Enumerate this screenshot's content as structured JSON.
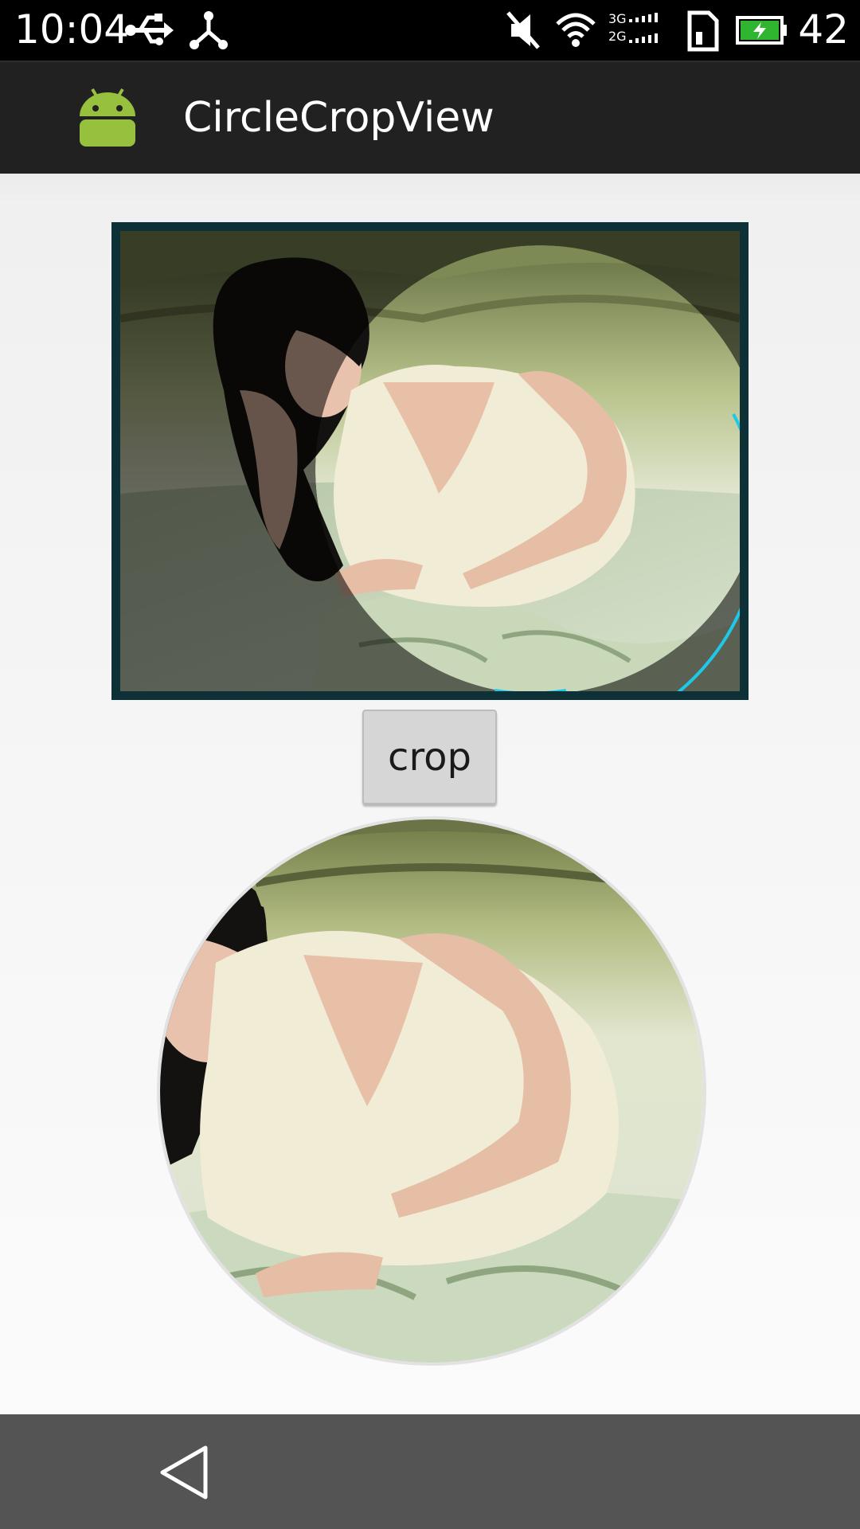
{
  "status_bar": {
    "time": "10:04",
    "battery_level": "42",
    "icons": [
      "usb-icon",
      "share-icon",
      "mute-icon",
      "wifi-icon",
      "signal-3g-2g-icon",
      "sim-icon",
      "battery-charging-icon"
    ],
    "network_labels": [
      "3G",
      "2G"
    ]
  },
  "action_bar": {
    "title": "CircleCropView",
    "icon": "android-icon"
  },
  "main": {
    "crop_button_label": "crop"
  },
  "nav_bar": {
    "back_icon": "back-icon"
  },
  "colors": {
    "status_bar": "#000000",
    "action_bar": "#212121",
    "crop_frame": "#0e3138",
    "crop_circle_accent": "#1ec8e8",
    "android_green": "#97c03e",
    "nav_bar": "#545454"
  }
}
